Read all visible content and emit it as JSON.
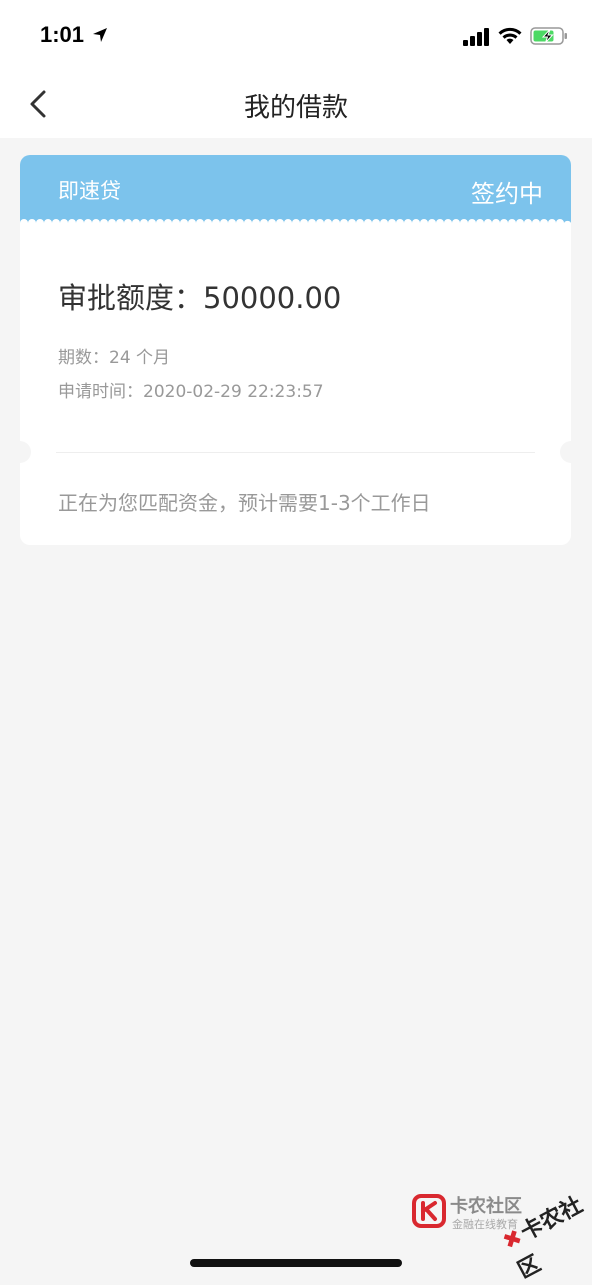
{
  "status_bar": {
    "time": "1:01"
  },
  "nav": {
    "title": "我的借款"
  },
  "loan_card": {
    "product_name": "即速贷",
    "status": "签约中",
    "amount_line": "审批额度：50000.00",
    "period_line": "期数：24 个月",
    "apply_time_line": "申请时间：2020-02-29 22:23:57",
    "message": "正在为您匹配资金，预计需要1-3个工作日"
  },
  "watermark": {
    "title": "卡农社区",
    "subtitle": "金融在线教育",
    "stamp": "卡农社区"
  },
  "colors": {
    "header_blue": "#7cc3ec",
    "background": "#f5f5f5",
    "battery_green": "#4cd964"
  }
}
